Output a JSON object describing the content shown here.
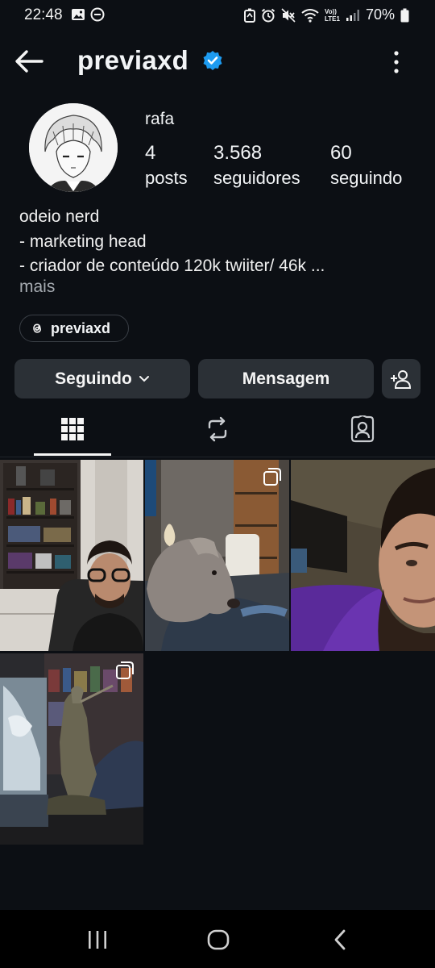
{
  "status_bar": {
    "time": "22:48",
    "left_icons": [
      "gallery-icon",
      "minus-circle-icon"
    ],
    "right_icons": [
      "screenshot-icon",
      "alarm-icon",
      "mute-icon",
      "wifi-icon",
      "volte-icon",
      "signal-icon"
    ],
    "volte_top": "Vo))",
    "volte_bottom": "LTE1",
    "battery": "70%"
  },
  "header": {
    "username": "previaxd",
    "verified": true
  },
  "profile": {
    "display_name": "rafa",
    "stats": [
      {
        "value": "4",
        "label": "posts"
      },
      {
        "value": "3.568",
        "label": "seguidores"
      },
      {
        "value": "60",
        "label": "seguindo"
      }
    ],
    "bio_lines": [
      "odeio nerd",
      "- marketing head",
      "- criador de conteúdo 120k twiiter/ 46k ..."
    ],
    "more_label": "mais",
    "threads_handle": "previaxd"
  },
  "actions": {
    "following_label": "Seguindo",
    "message_label": "Mensagem"
  },
  "tabs": [
    {
      "name": "grid-icon",
      "active": true
    },
    {
      "name": "reels-repost-icon",
      "active": false
    },
    {
      "name": "tagged-icon",
      "active": false
    }
  ],
  "colors": {
    "background": "#0c0f14",
    "button": "#2b3036",
    "verified": "#1d9bf0",
    "muted_text": "#a6abb1"
  },
  "posts": [
    {
      "subject": "man with glasses in room with shelves",
      "multi": false
    },
    {
      "subject": "dog lying on blanket",
      "multi": true
    },
    {
      "subject": "close-up selfie of bearded man",
      "multi": false
    },
    {
      "subject": "collectible statue figure",
      "multi": true
    }
  ]
}
